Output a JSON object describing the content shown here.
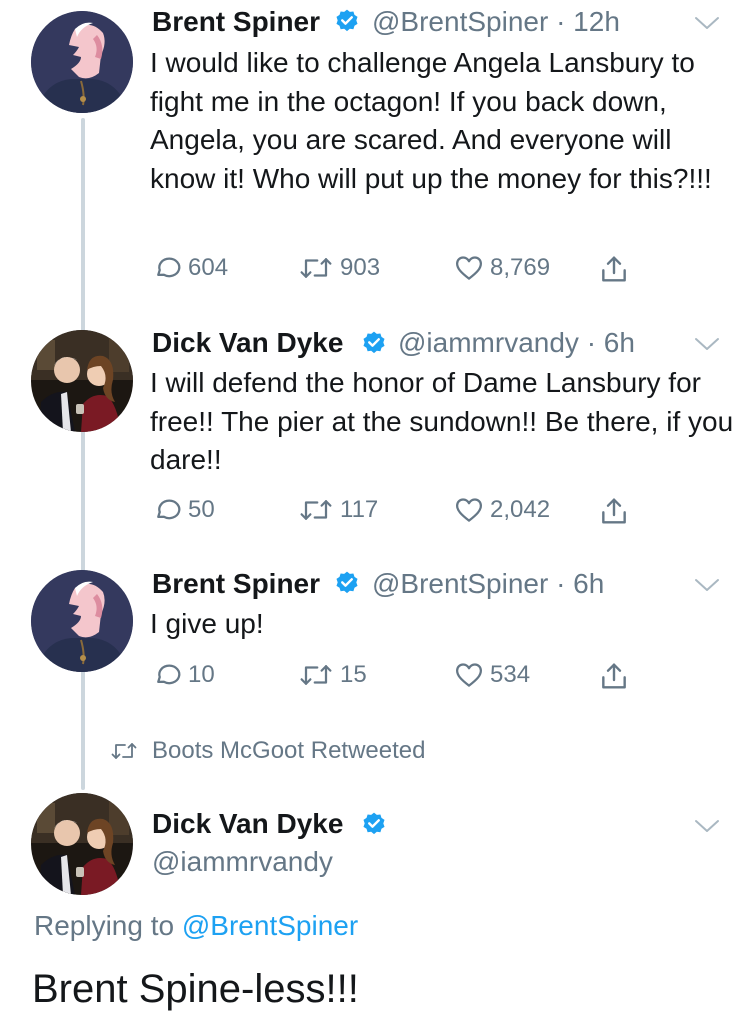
{
  "colors": {
    "text": "#14171a",
    "muted": "#657786",
    "link": "#1da1f2",
    "verified": "#1da1f2",
    "thread_line": "#ccd6dd"
  },
  "tweets": [
    {
      "author_name": "Brent Spiner",
      "handle": "@BrentSpiner",
      "time": "· 12h",
      "avatar_icon": "brent-spiner-avatar",
      "text": "I would like to challenge Angela Lansbury to fight me in the octagon! If you back down, Angela, you are scared. And everyone will know it! Who will put up the money for this?!!!",
      "replies": "604",
      "retweets": "903",
      "likes": "8,769"
    },
    {
      "author_name": "Dick Van Dyke",
      "handle": "@iammrvandy",
      "time": "· 6h",
      "avatar_icon": "dick-van-dyke-avatar",
      "text": "I will defend the honor of Dame Lansbury for free!! The pier at the sundown!! Be there, if you dare!!",
      "replies": "50",
      "retweets": "117",
      "likes": "2,042"
    },
    {
      "author_name": "Brent Spiner",
      "handle": "@BrentSpiner",
      "time": "· 6h",
      "avatar_icon": "brent-spiner-avatar",
      "text": "I give up!",
      "replies": "10",
      "retweets": "15",
      "likes": "534"
    }
  ],
  "retweet_context": "Boots McGoot Retweeted",
  "focused_tweet": {
    "author_name": "Dick Van Dyke",
    "handle": "@iammrvandy",
    "avatar_icon": "dick-van-dyke-avatar",
    "replying_prefix": "Replying to",
    "replying_to": "@BrentSpiner",
    "text": "Brent Spine-less!!!"
  }
}
